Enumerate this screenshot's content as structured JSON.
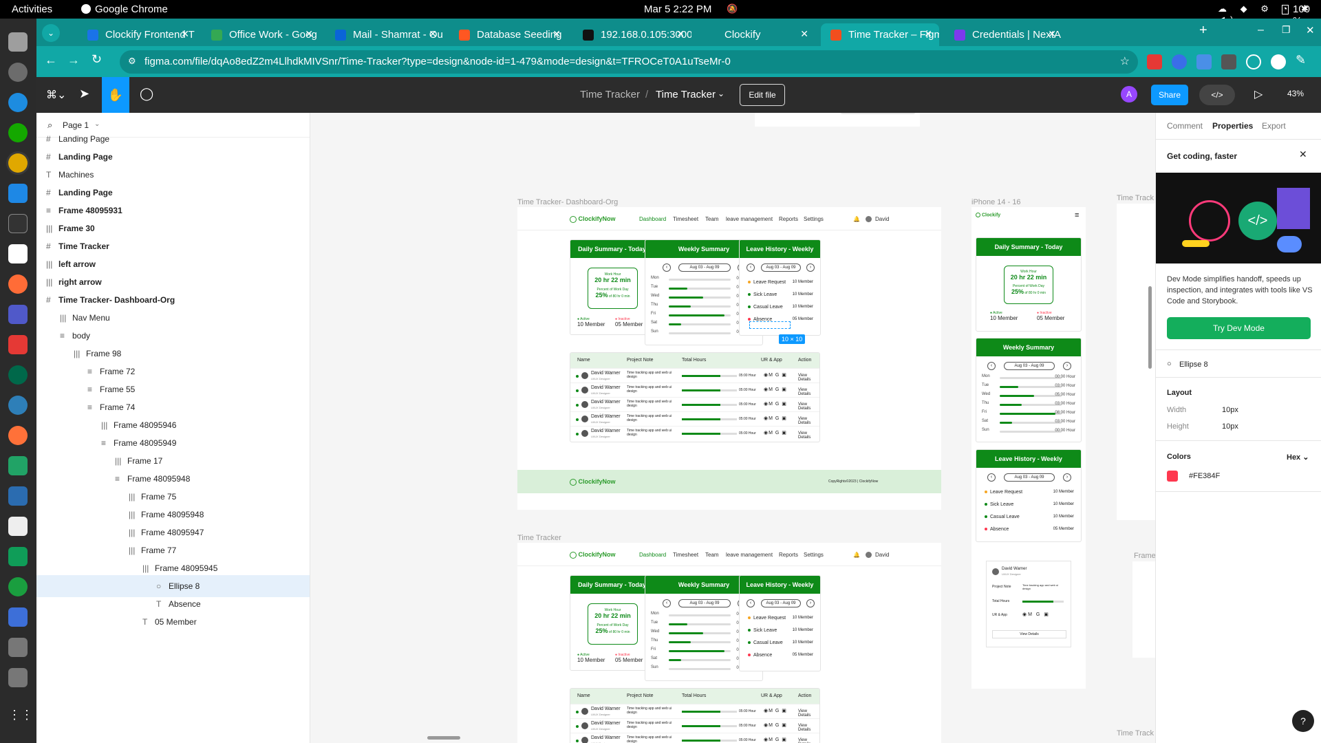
{
  "system": {
    "activities": "Activities",
    "app": "Google Chrome",
    "date": "Mar 5  2:22 PM",
    "battery": "100 %"
  },
  "tabs": [
    {
      "label": "Clockify Frontend T",
      "fav": "#1a73e8",
      "active": false
    },
    {
      "label": "Office Work - Goog",
      "fav": "#34a853",
      "active": false
    },
    {
      "label": "Mail - Shamrat - Ou",
      "fav": "#0a64d8",
      "active": false
    },
    {
      "label": "Database Seeding",
      "fav": "#ff5722",
      "active": false
    },
    {
      "label": "192.168.0.105:3000",
      "fav": "#111111",
      "active": false
    },
    {
      "label": "Clockify",
      "fav": "#0e8d8b",
      "active": false
    },
    {
      "label": "Time Tracker – Figm",
      "fav": "#f24e1e",
      "active": true
    },
    {
      "label": "Credentials | NextA",
      "fav": "#7c3aed",
      "active": false
    }
  ],
  "address": {
    "url": "figma.com/file/dqAo8edZ2m4LlhdkMIVSnr/Time-Tracker?type=design&node-id=1-479&mode=design&t=TFROCeT0A1uTseMr-0"
  },
  "figma": {
    "breadcrumb_project": "Time Tracker",
    "breadcrumb_sep": "/",
    "breadcrumb_file": "Time Tracker",
    "edit_file": "Edit file",
    "avatar": "A",
    "share": "Share",
    "zoom": "43%",
    "page": "Page 1"
  },
  "layers": [
    {
      "name": "Landing Page",
      "icon": "#",
      "indent": 0,
      "bold": false,
      "sel": false
    },
    {
      "name": "Landing Page",
      "icon": "#",
      "indent": 0,
      "bold": true,
      "sel": false
    },
    {
      "name": "Machines",
      "icon": "T",
      "indent": 0,
      "bold": false,
      "sel": false
    },
    {
      "name": "Landing Page",
      "icon": "#",
      "indent": 0,
      "bold": true,
      "sel": false
    },
    {
      "name": "Frame 48095931",
      "icon": "≡",
      "indent": 0,
      "bold": true,
      "sel": false
    },
    {
      "name": "Frame 30",
      "icon": "|||",
      "indent": 0,
      "bold": true,
      "sel": false
    },
    {
      "name": "Time Tracker",
      "icon": "#",
      "indent": 0,
      "bold": true,
      "sel": false
    },
    {
      "name": "left arrow",
      "icon": "|||",
      "indent": 0,
      "bold": true,
      "sel": false
    },
    {
      "name": "right arrow",
      "icon": "|||",
      "indent": 0,
      "bold": true,
      "sel": false
    },
    {
      "name": "Time Tracker- Dashboard-Org",
      "icon": "#",
      "indent": 0,
      "bold": true,
      "sel": false
    },
    {
      "name": "Nav Menu",
      "icon": "|||",
      "indent": 1,
      "bold": false,
      "sel": false
    },
    {
      "name": "body",
      "icon": "≡",
      "indent": 1,
      "bold": false,
      "sel": false
    },
    {
      "name": "Frame 98",
      "icon": "|||",
      "indent": 2,
      "bold": false,
      "sel": false
    },
    {
      "name": "Frame 72",
      "icon": "≡",
      "indent": 3,
      "bold": false,
      "sel": false
    },
    {
      "name": "Frame 55",
      "icon": "≡",
      "indent": 3,
      "bold": false,
      "sel": false
    },
    {
      "name": "Frame 74",
      "icon": "≡",
      "indent": 3,
      "bold": false,
      "sel": false
    },
    {
      "name": "Frame 48095946",
      "icon": "|||",
      "indent": 4,
      "bold": false,
      "sel": false
    },
    {
      "name": "Frame 48095949",
      "icon": "≡",
      "indent": 4,
      "bold": false,
      "sel": false
    },
    {
      "name": "Frame 17",
      "icon": "|||",
      "indent": 5,
      "bold": false,
      "sel": false
    },
    {
      "name": "Frame 48095948",
      "icon": "≡",
      "indent": 5,
      "bold": false,
      "sel": false
    },
    {
      "name": "Frame 75",
      "icon": "|||",
      "indent": 6,
      "bold": false,
      "sel": false
    },
    {
      "name": "Frame 48095948",
      "icon": "|||",
      "indent": 6,
      "bold": false,
      "sel": false
    },
    {
      "name": "Frame 48095947",
      "icon": "|||",
      "indent": 6,
      "bold": false,
      "sel": false
    },
    {
      "name": "Frame 77",
      "icon": "|||",
      "indent": 6,
      "bold": false,
      "sel": false
    },
    {
      "name": "Frame 48095945",
      "icon": "|||",
      "indent": 7,
      "bold": false,
      "sel": false
    },
    {
      "name": "Ellipse 8",
      "icon": "○",
      "indent": 8,
      "bold": false,
      "sel": true
    },
    {
      "name": "Absence",
      "icon": "T",
      "indent": 8,
      "bold": false,
      "sel": false
    },
    {
      "name": "05 Member",
      "icon": "T",
      "indent": 7,
      "bold": false,
      "sel": false
    }
  ],
  "props": {
    "tabs": [
      "Comment",
      "Properties",
      "Export"
    ],
    "promo_title": "Get coding, faster",
    "promo_text": "Dev Mode simplifies handoff, speeds up inspection, and integrates with tools like VS Code and Storybook.",
    "promo_btn": "Try Dev Mode",
    "element": "Ellipse 8",
    "layout": "Layout",
    "width_label": "Width",
    "width_val": "10px",
    "height_label": "Height",
    "height_val": "10px",
    "colors": "Colors",
    "hex": "Hex",
    "color_val": "#FE384F",
    "accent": "#fe384f"
  },
  "canvas": {
    "frame_labels": [
      "Time Tracker- Dashboard-Org",
      "iPhone 14 - 16",
      "Time Tracker",
      "Time Track",
      "Frame",
      "Time Track"
    ],
    "logo": "ClockifyNow",
    "mobile_logo": "Clockify",
    "nav": [
      "Dashboard",
      "Timesheet",
      "Team",
      "leave management",
      "Reports",
      "Settings"
    ],
    "user": "David",
    "daily": {
      "title": "Daily Summary - Today",
      "work": "Work Hour",
      "time": "20 hr 22 min",
      "percent_label": "Percent of Work Day",
      "percent": "25%",
      "percent_of": "of 80 hr 0 min",
      "active_label": "Active",
      "active": "10 Member",
      "inactive_label": "Inactive",
      "inactive": "05 Member"
    },
    "weekly": {
      "title": "Weekly Summary",
      "range": "Aug 03 - Aug 09",
      "days": [
        {
          "d": "Mon",
          "h": "00:00 Hour",
          "v": 0
        },
        {
          "d": "Tue",
          "h": "03:00 Hour",
          "v": 0.3
        },
        {
          "d": "Wed",
          "h": "05:00 Hour",
          "v": 0.55
        },
        {
          "d": "Thu",
          "h": "03:00 Hour",
          "v": 0.35
        },
        {
          "d": "Fri",
          "h": "08:00 Hour",
          "v": 0.9
        },
        {
          "d": "Sat",
          "h": "03:00 Hour",
          "v": 0.2
        },
        {
          "d": "Sun",
          "h": "00:00 Hour",
          "v": 0
        }
      ]
    },
    "leave": {
      "title": "Leave History - Weekly",
      "range": "Aug 03 - Aug 09",
      "items": [
        {
          "label": "Leave Request",
          "value": "10 Member",
          "color": "#f5a623"
        },
        {
          "label": "Sick Leave",
          "value": "10 Member",
          "color": "#0e8a18"
        },
        {
          "label": "Casual Leave",
          "value": "10 Member",
          "color": "#0e8a18"
        },
        {
          "label": "Absence",
          "value": "05 Member",
          "color": "#fe384f"
        }
      ]
    },
    "selection_size": "10 × 10",
    "table": {
      "headers": [
        "Name",
        "Project Note",
        "Total Hours",
        "UR & App",
        "Action"
      ],
      "rows": [
        {
          "name": "David Warner",
          "role": "UI/UX Designer",
          "note": "Time tracking app and web ui design",
          "hours": "05:00 Hour",
          "action": "View Details"
        },
        {
          "name": "David Warner",
          "role": "UI/UX Designer",
          "note": "Time tracking app and web ui design",
          "hours": "05:00 Hour",
          "action": "View Details"
        },
        {
          "name": "David Warner",
          "role": "UI/UX Designer",
          "note": "Time tracking app and web ui design",
          "hours": "05:00 Hour",
          "action": "View Details"
        },
        {
          "name": "David Warner",
          "role": "UI/UX Designer",
          "note": "Time tracking app and web ui design",
          "hours": "05:00 Hour",
          "action": "View Details"
        },
        {
          "name": "David Warner",
          "role": "UI/UX Designer",
          "note": "Time tracking app and web ui design",
          "hours": "05:00 Hour",
          "action": "View Details"
        }
      ]
    },
    "copyright": "CopyRights©2023 | ClockifyNow",
    "mobile_card": {
      "name": "David Warner",
      "role": "UI/UX Designer",
      "note_label": "Project Note",
      "note": "Time tracking app and web ui design",
      "hours_label": "Total Hours",
      "app_label": "UR & App",
      "btn": "View Details"
    }
  }
}
